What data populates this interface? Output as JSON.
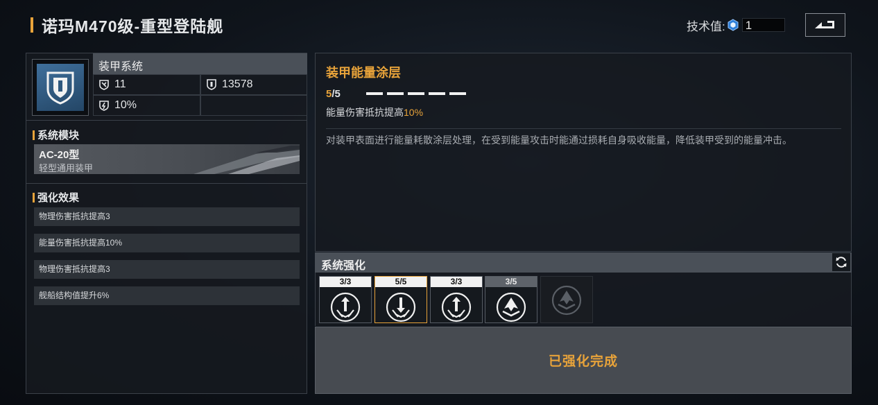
{
  "header": {
    "title": "诺玛M470级-重型登陆舰",
    "tech_label": "技术值:",
    "tech_value": "1",
    "back_icon": "back-arrow-icon"
  },
  "left": {
    "system_name": "装甲系统",
    "stats": [
      {
        "icon": "physical-armor-icon",
        "value": "11"
      },
      {
        "icon": "hull-shield-icon",
        "value": "13578"
      },
      {
        "icon": "energy-armor-icon",
        "value": "10%"
      }
    ],
    "module_section_label": "系统模块",
    "module": {
      "name": "AC-20型",
      "subtitle": "轻型通用装甲"
    },
    "effects_section_label": "强化效果",
    "effects": [
      "物理伤害抵抗提高3",
      "能量伤害抵抗提高10%",
      "物理伤害抵抗提高3",
      "舰船结构值提升6%"
    ]
  },
  "detail": {
    "title": "装甲能量涂层",
    "level_current": "5",
    "level_max": "/5",
    "level_pips": 5,
    "effect_prefix": "能量伤害抵抗提高",
    "effect_value": "10%",
    "description": "对装甲表面进行能量耗散涂层处理，在受到能量攻击时能通过损耗自身吸收能量，降低装甲受到的能量冲击。"
  },
  "enhance": {
    "title": "系统强化",
    "slots": [
      {
        "count": "3/3",
        "icon": "arrow-up-shield-icon",
        "state": "done"
      },
      {
        "count": "5/5",
        "icon": "arrow-down-shield-icon",
        "state": "selected"
      },
      {
        "count": "3/3",
        "icon": "arrow-up-shield-icon",
        "state": "done"
      },
      {
        "count": "3/5",
        "icon": "chevron-shield-icon",
        "state": "partial"
      },
      {
        "count": "",
        "icon": "chevron-shield-icon",
        "state": "locked"
      }
    ],
    "status": "已强化完成"
  },
  "colors": {
    "accent": "#e8a33a",
    "panel_header": "#4a5058"
  }
}
